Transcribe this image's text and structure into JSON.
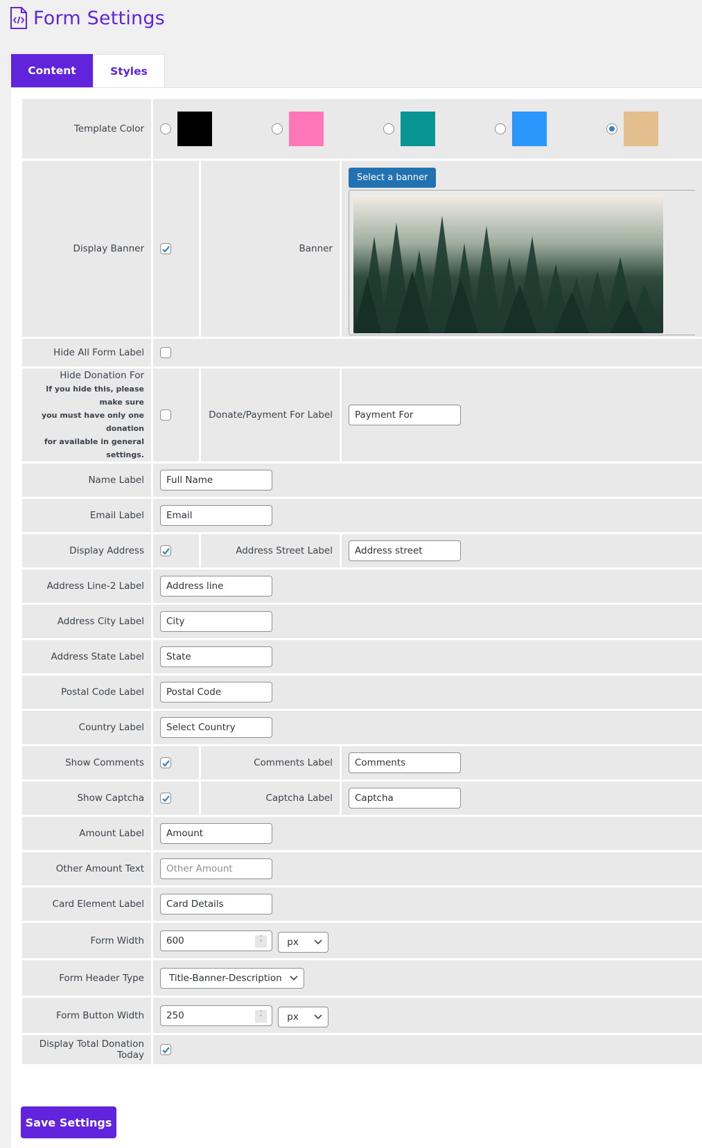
{
  "header": {
    "title": "Form Settings",
    "icon": "file-code-icon"
  },
  "tabs": [
    {
      "label": "Content",
      "active": true
    },
    {
      "label": "Styles",
      "active": false
    }
  ],
  "template_color": {
    "label": "Template Color",
    "options": [
      {
        "color": "#000000",
        "selected": false
      },
      {
        "color": "#ff77b9",
        "selected": false
      },
      {
        "color": "#099693",
        "selected": false
      },
      {
        "color": "#2b97fd",
        "selected": false
      },
      {
        "color": "#e3bf8e",
        "selected": true
      }
    ]
  },
  "display_banner": {
    "label": "Display Banner",
    "checked": true,
    "banner_label": "Banner",
    "select_button": "Select a banner",
    "image_alt": "misty pine forest"
  },
  "hide_all_form_label": {
    "label": "Hide All Form Label",
    "checked": false
  },
  "hide_donation_for": {
    "label": "Hide Donation For",
    "hint": [
      "If you hide this, please make sure",
      "you must have only one donation",
      "for available in general settings."
    ],
    "checked": false,
    "field_label": "Donate/Payment For Label",
    "value": "Payment For"
  },
  "fields": {
    "name": {
      "label": "Name Label",
      "value": "Full Name"
    },
    "email": {
      "label": "Email Label",
      "value": "Email"
    },
    "address_line2": {
      "label": "Address Line-2 Label",
      "value": "Address line"
    },
    "city": {
      "label": "Address City Label",
      "value": "City"
    },
    "state": {
      "label": "Address State Label",
      "value": "State"
    },
    "postal": {
      "label": "Postal Code Label",
      "value": "Postal Code"
    },
    "country": {
      "label": "Country Label",
      "value": "Select Country"
    },
    "amount": {
      "label": "Amount Label",
      "value": "Amount"
    },
    "other_amount": {
      "label": "Other Amount Text",
      "value": "",
      "placeholder": "Other Amount"
    },
    "card": {
      "label": "Card Element Label",
      "value": "Card Details"
    }
  },
  "display_address": {
    "label": "Display Address",
    "checked": true,
    "field_label": "Address Street Label",
    "value": "Address street"
  },
  "show_comments": {
    "label": "Show Comments",
    "checked": true,
    "field_label": "Comments Label",
    "value": "Comments"
  },
  "show_captcha": {
    "label": "Show Captcha",
    "checked": true,
    "field_label": "Captcha Label",
    "value": "Captcha"
  },
  "form_width": {
    "label": "Form Width",
    "value": "600",
    "unit": "px"
  },
  "form_header_type": {
    "label": "Form Header Type",
    "value": "Title-Banner-Description"
  },
  "form_button_width": {
    "label": "Form Button Width",
    "value": "250",
    "unit": "px"
  },
  "display_total_donation": {
    "label": "Display Total Donation Today",
    "checked": true
  },
  "save_button": "Save Settings",
  "colors": {
    "accent": "#6124dc",
    "wp_blue": "#2271b1",
    "check_blue": "#3582c4"
  }
}
